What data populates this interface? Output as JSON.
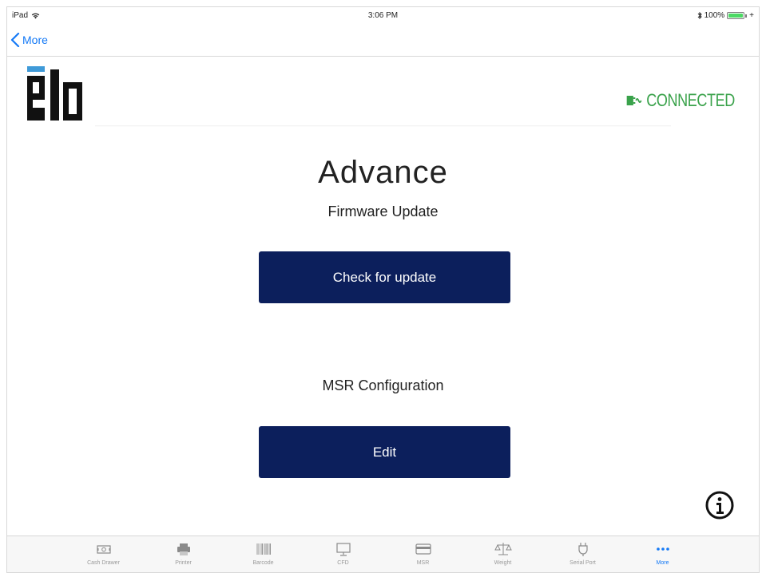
{
  "status_bar": {
    "device": "iPad",
    "time": "3:06 PM",
    "battery": "100%",
    "battery_level": 1.0
  },
  "nav": {
    "back_label": "More"
  },
  "header": {
    "connection_status": "CONNECTED",
    "status_color": "#3aa24b"
  },
  "main": {
    "title": "Advance",
    "firmware_heading": "Firmware Update",
    "check_update_label": "Check for update",
    "msr_heading": "MSR Configuration",
    "edit_label": "Edit"
  },
  "colors": {
    "button_bg": "#0c1f5c",
    "accent": "#1479f6"
  },
  "tabs": [
    {
      "label": "Cash Drawer",
      "icon": "cash-drawer-icon"
    },
    {
      "label": "Printer",
      "icon": "printer-icon"
    },
    {
      "label": "Barcode",
      "icon": "barcode-icon"
    },
    {
      "label": "CFD",
      "icon": "monitor-icon"
    },
    {
      "label": "MSR",
      "icon": "card-icon"
    },
    {
      "label": "Weight",
      "icon": "scale-icon"
    },
    {
      "label": "Serial Port",
      "icon": "plug-icon"
    },
    {
      "label": "More",
      "icon": "more-icon",
      "active": true
    }
  ]
}
